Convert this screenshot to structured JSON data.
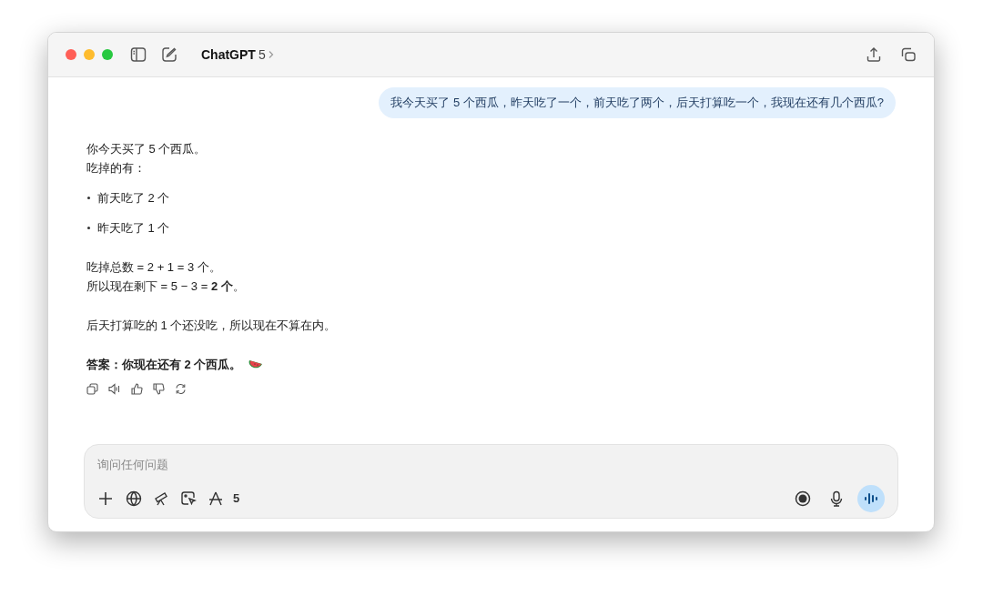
{
  "window": {
    "title": "ChatGPT",
    "model": "5"
  },
  "user_message": "我今天买了 5 个西瓜，昨天吃了一个，前天吃了两个，后天打算吃一个，我现在还有几个西瓜?",
  "assistant_message": [
    {
      "kind": "paragraph",
      "lines": [
        "你今天买了 5 个西瓜。",
        "吃掉的有："
      ]
    },
    {
      "kind": "bullet",
      "lines": [
        "前天吃了 2 个"
      ]
    },
    {
      "kind": "bullet",
      "lines": [
        "昨天吃了 1 个"
      ]
    },
    {
      "kind": "paragraph",
      "lines": [
        "吃掉总数 = 2 + 1 = 3 个。",
        "所以现在剩下 = 5 − 3 = **2 个**。"
      ]
    },
    {
      "kind": "paragraph",
      "lines": [
        "后天打算吃的 1 个还没吃，所以现在不算在内。"
      ]
    },
    {
      "kind": "answer",
      "lines": [
        "答案：你现在还有 2 个西瓜。"
      ]
    }
  ],
  "composer": {
    "placeholder": "询问任何问题",
    "tool_count": "5"
  }
}
